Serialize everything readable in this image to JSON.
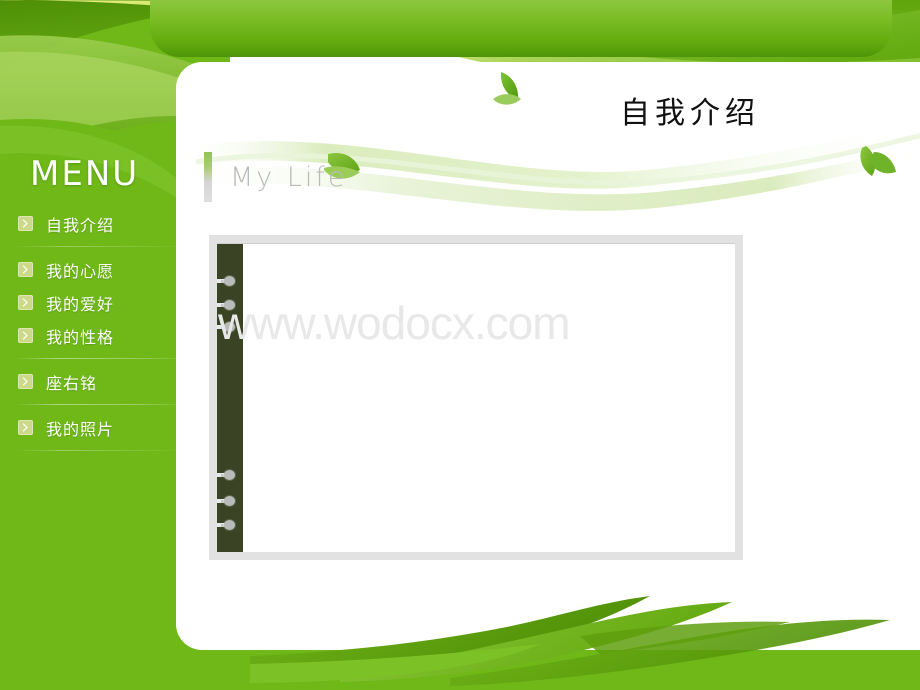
{
  "slide": {
    "page_title": "自我介绍",
    "section_heading": "My Life",
    "watermark": "www.wodocx.com",
    "theme": {
      "green": "#6fb818",
      "banner_green_light": "#8ec63f",
      "banner_green_dark": "#4e9409",
      "bullet": "#cdd98a",
      "spine": "#3b4325",
      "box_border": "#e2e2e2",
      "heading_gray": "#b9b9b9",
      "watermark_gray": "#e8e8e8"
    }
  },
  "sidebar": {
    "title": "MENU",
    "items": [
      {
        "label": "自我介绍",
        "icon": "chevron-right-icon"
      },
      {
        "label": "我的心愿",
        "icon": "chevron-right-icon"
      },
      {
        "label": "我的爱好",
        "icon": "chevron-right-icon"
      },
      {
        "label": "我的性格",
        "icon": "chevron-right-icon"
      },
      {
        "label": "座右铭",
        "icon": "chevron-right-icon"
      },
      {
        "label": "我的照片",
        "icon": "chevron-right-icon"
      }
    ]
  },
  "content": {
    "body_text": ""
  }
}
